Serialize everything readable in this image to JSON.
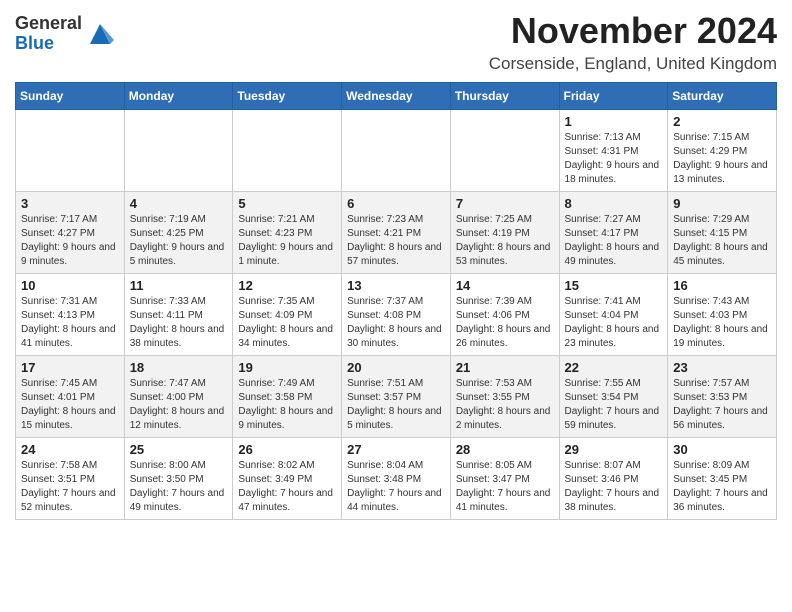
{
  "logo": {
    "general": "General",
    "blue": "Blue"
  },
  "title": "November 2024",
  "location": "Corsenside, England, United Kingdom",
  "weekdays": [
    "Sunday",
    "Monday",
    "Tuesday",
    "Wednesday",
    "Thursday",
    "Friday",
    "Saturday"
  ],
  "rows": [
    [
      {
        "day": "",
        "detail": ""
      },
      {
        "day": "",
        "detail": ""
      },
      {
        "day": "",
        "detail": ""
      },
      {
        "day": "",
        "detail": ""
      },
      {
        "day": "",
        "detail": ""
      },
      {
        "day": "1",
        "detail": "Sunrise: 7:13 AM\nSunset: 4:31 PM\nDaylight: 9 hours and 18 minutes."
      },
      {
        "day": "2",
        "detail": "Sunrise: 7:15 AM\nSunset: 4:29 PM\nDaylight: 9 hours and 13 minutes."
      }
    ],
    [
      {
        "day": "3",
        "detail": "Sunrise: 7:17 AM\nSunset: 4:27 PM\nDaylight: 9 hours and 9 minutes."
      },
      {
        "day": "4",
        "detail": "Sunrise: 7:19 AM\nSunset: 4:25 PM\nDaylight: 9 hours and 5 minutes."
      },
      {
        "day": "5",
        "detail": "Sunrise: 7:21 AM\nSunset: 4:23 PM\nDaylight: 9 hours and 1 minute."
      },
      {
        "day": "6",
        "detail": "Sunrise: 7:23 AM\nSunset: 4:21 PM\nDaylight: 8 hours and 57 minutes."
      },
      {
        "day": "7",
        "detail": "Sunrise: 7:25 AM\nSunset: 4:19 PM\nDaylight: 8 hours and 53 minutes."
      },
      {
        "day": "8",
        "detail": "Sunrise: 7:27 AM\nSunset: 4:17 PM\nDaylight: 8 hours and 49 minutes."
      },
      {
        "day": "9",
        "detail": "Sunrise: 7:29 AM\nSunset: 4:15 PM\nDaylight: 8 hours and 45 minutes."
      }
    ],
    [
      {
        "day": "10",
        "detail": "Sunrise: 7:31 AM\nSunset: 4:13 PM\nDaylight: 8 hours and 41 minutes."
      },
      {
        "day": "11",
        "detail": "Sunrise: 7:33 AM\nSunset: 4:11 PM\nDaylight: 8 hours and 38 minutes."
      },
      {
        "day": "12",
        "detail": "Sunrise: 7:35 AM\nSunset: 4:09 PM\nDaylight: 8 hours and 34 minutes."
      },
      {
        "day": "13",
        "detail": "Sunrise: 7:37 AM\nSunset: 4:08 PM\nDaylight: 8 hours and 30 minutes."
      },
      {
        "day": "14",
        "detail": "Sunrise: 7:39 AM\nSunset: 4:06 PM\nDaylight: 8 hours and 26 minutes."
      },
      {
        "day": "15",
        "detail": "Sunrise: 7:41 AM\nSunset: 4:04 PM\nDaylight: 8 hours and 23 minutes."
      },
      {
        "day": "16",
        "detail": "Sunrise: 7:43 AM\nSunset: 4:03 PM\nDaylight: 8 hours and 19 minutes."
      }
    ],
    [
      {
        "day": "17",
        "detail": "Sunrise: 7:45 AM\nSunset: 4:01 PM\nDaylight: 8 hours and 15 minutes."
      },
      {
        "day": "18",
        "detail": "Sunrise: 7:47 AM\nSunset: 4:00 PM\nDaylight: 8 hours and 12 minutes."
      },
      {
        "day": "19",
        "detail": "Sunrise: 7:49 AM\nSunset: 3:58 PM\nDaylight: 8 hours and 9 minutes."
      },
      {
        "day": "20",
        "detail": "Sunrise: 7:51 AM\nSunset: 3:57 PM\nDaylight: 8 hours and 5 minutes."
      },
      {
        "day": "21",
        "detail": "Sunrise: 7:53 AM\nSunset: 3:55 PM\nDaylight: 8 hours and 2 minutes."
      },
      {
        "day": "22",
        "detail": "Sunrise: 7:55 AM\nSunset: 3:54 PM\nDaylight: 7 hours and 59 minutes."
      },
      {
        "day": "23",
        "detail": "Sunrise: 7:57 AM\nSunset: 3:53 PM\nDaylight: 7 hours and 56 minutes."
      }
    ],
    [
      {
        "day": "24",
        "detail": "Sunrise: 7:58 AM\nSunset: 3:51 PM\nDaylight: 7 hours and 52 minutes."
      },
      {
        "day": "25",
        "detail": "Sunrise: 8:00 AM\nSunset: 3:50 PM\nDaylight: 7 hours and 49 minutes."
      },
      {
        "day": "26",
        "detail": "Sunrise: 8:02 AM\nSunset: 3:49 PM\nDaylight: 7 hours and 47 minutes."
      },
      {
        "day": "27",
        "detail": "Sunrise: 8:04 AM\nSunset: 3:48 PM\nDaylight: 7 hours and 44 minutes."
      },
      {
        "day": "28",
        "detail": "Sunrise: 8:05 AM\nSunset: 3:47 PM\nDaylight: 7 hours and 41 minutes."
      },
      {
        "day": "29",
        "detail": "Sunrise: 8:07 AM\nSunset: 3:46 PM\nDaylight: 7 hours and 38 minutes."
      },
      {
        "day": "30",
        "detail": "Sunrise: 8:09 AM\nSunset: 3:45 PM\nDaylight: 7 hours and 36 minutes."
      }
    ]
  ]
}
